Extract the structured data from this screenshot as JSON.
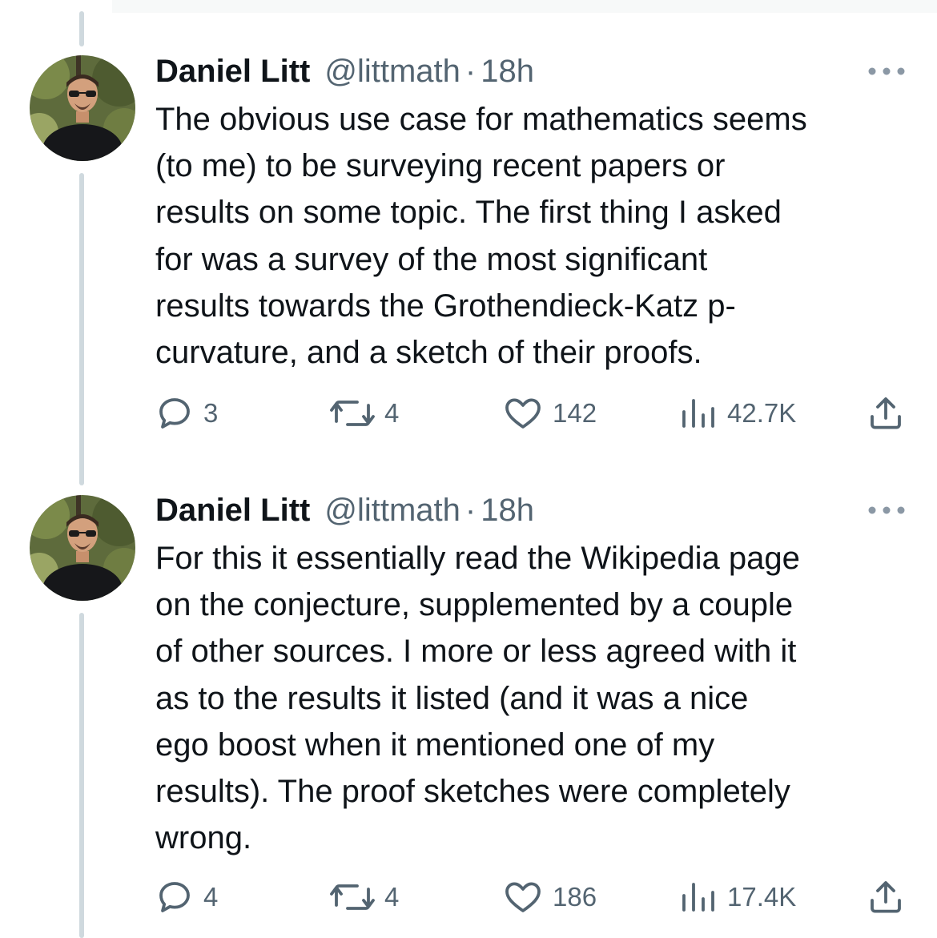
{
  "tweets": [
    {
      "author": {
        "name": "Daniel Litt",
        "handle": "@littmath",
        "separator": "·",
        "time": "18h"
      },
      "text_lines": [
        "The obvious use case for mathematics seems",
        "(to me) to be surveying recent papers or",
        "results on some topic. The first thing I asked",
        "for was a survey of the most significant",
        "results towards the Grothendieck-Katz p-",
        "curvature, and a sketch of their proofs."
      ],
      "actions": {
        "replies": "3",
        "reposts": "4",
        "likes": "142",
        "views": "42.7K"
      }
    },
    {
      "author": {
        "name": "Daniel Litt",
        "handle": "@littmath",
        "separator": "·",
        "time": "18h"
      },
      "text_lines": [
        "For this it essentially read the Wikipedia page",
        "on the conjecture, supplemented by a couple",
        "of other sources. I more or less agreed with it",
        "as to the results it listed (and it was a nice",
        "ego boost when it mentioned one of my",
        "results). The proof sketches were completely",
        "wrong."
      ],
      "actions": {
        "replies": "4",
        "reposts": "4",
        "likes": "186",
        "views": "17.4K"
      }
    }
  ],
  "icons": {
    "reply": "speech-bubble-icon",
    "repost": "repost-arrows-icon",
    "like": "heart-icon",
    "views": "bar-chart-icon",
    "share": "share-upload-icon",
    "more": "ellipsis-icon"
  },
  "colors": {
    "text_primary": "#0f1419",
    "text_secondary": "#536471",
    "thread_line": "#cfd9de"
  }
}
